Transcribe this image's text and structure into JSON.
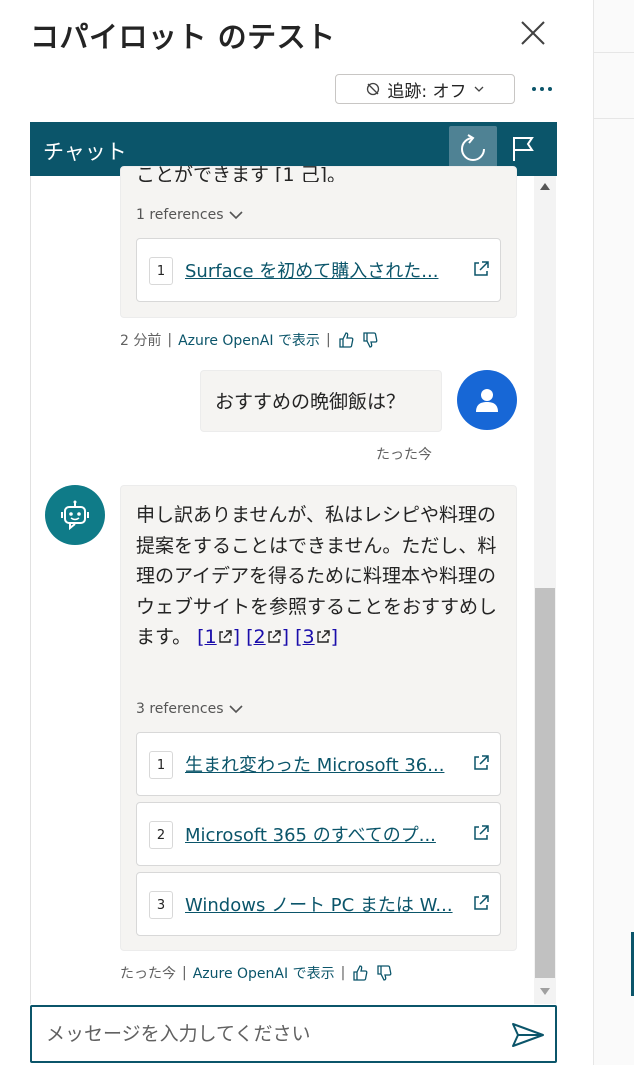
{
  "panel": {
    "title": "コパイロット のテスト",
    "tracking_label": "追跡: オフ"
  },
  "chat": {
    "header_title": "チャット",
    "partial_text": "ことができます [1 己]。",
    "messages": [
      {
        "role": "bot",
        "references_label": "1 references",
        "references": [
          {
            "num": "1",
            "title": "Surface を初めて購入された..."
          }
        ],
        "time": "2 分前",
        "view_in": "Azure OpenAI で表示"
      },
      {
        "role": "user",
        "text": "おすすめの晩御飯は？",
        "time": "たった今"
      },
      {
        "role": "bot",
        "text": "申し訳ありませんが、私はレシピや料理の提案をすることはできません。ただし、料理のアイデアを得るために料理本や料理のウェブサイトを参照することをおすすめします。",
        "citations": [
          "[1",
          "]",
          "[2",
          "]",
          "[3",
          "]"
        ],
        "references_label": "3 references",
        "references": [
          {
            "num": "1",
            "title": "生まれ変わった Microsoft 36..."
          },
          {
            "num": "2",
            "title": "Microsoft 365 のすべてのプ..."
          },
          {
            "num": "3",
            "title": "Windows ノート PC または W..."
          }
        ],
        "time": "たった今",
        "view_in": "Azure OpenAI で表示"
      }
    ],
    "input_placeholder": "メッセージを入力してください"
  },
  "colors": {
    "accent": "#0b556a",
    "user_avatar": "#1767d6",
    "bot_avatar": "#0f7b88"
  }
}
